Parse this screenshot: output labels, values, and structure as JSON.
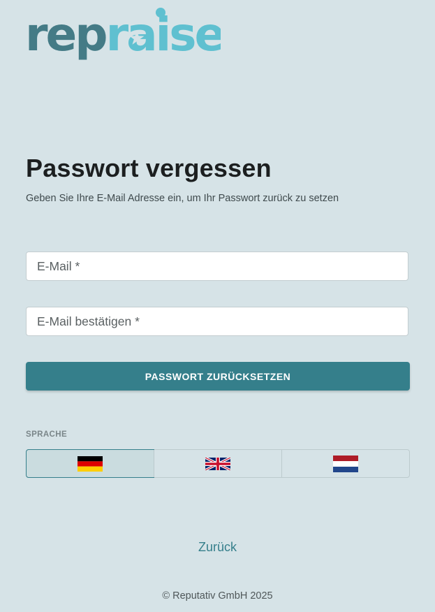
{
  "brand": {
    "logo_text": "repraise",
    "colors": {
      "dark": "#447b86",
      "light": "#5fc0d0"
    }
  },
  "page": {
    "title": "Passwort vergessen",
    "subtitle": "Geben Sie Ihre E-Mail Adresse ein, um Ihr Passwort zurück zu setzen"
  },
  "form": {
    "email_placeholder": "E-Mail *",
    "email_value": "",
    "email_confirm_placeholder": "E-Mail bestätigen *",
    "email_confirm_value": "",
    "submit_label": "PASSWORT ZURÜCKSETZEN"
  },
  "language": {
    "label": "SPRACHE",
    "options": [
      {
        "flag": "germany-flag-icon",
        "selected": true
      },
      {
        "flag": "uk-flag-icon",
        "selected": false
      },
      {
        "flag": "netherlands-flag-icon",
        "selected": false
      }
    ]
  },
  "back_link": "Zurück",
  "footer": "© Reputativ GmbH 2025",
  "colors": {
    "background": "#d6e3e7",
    "accent": "#357f8b"
  }
}
